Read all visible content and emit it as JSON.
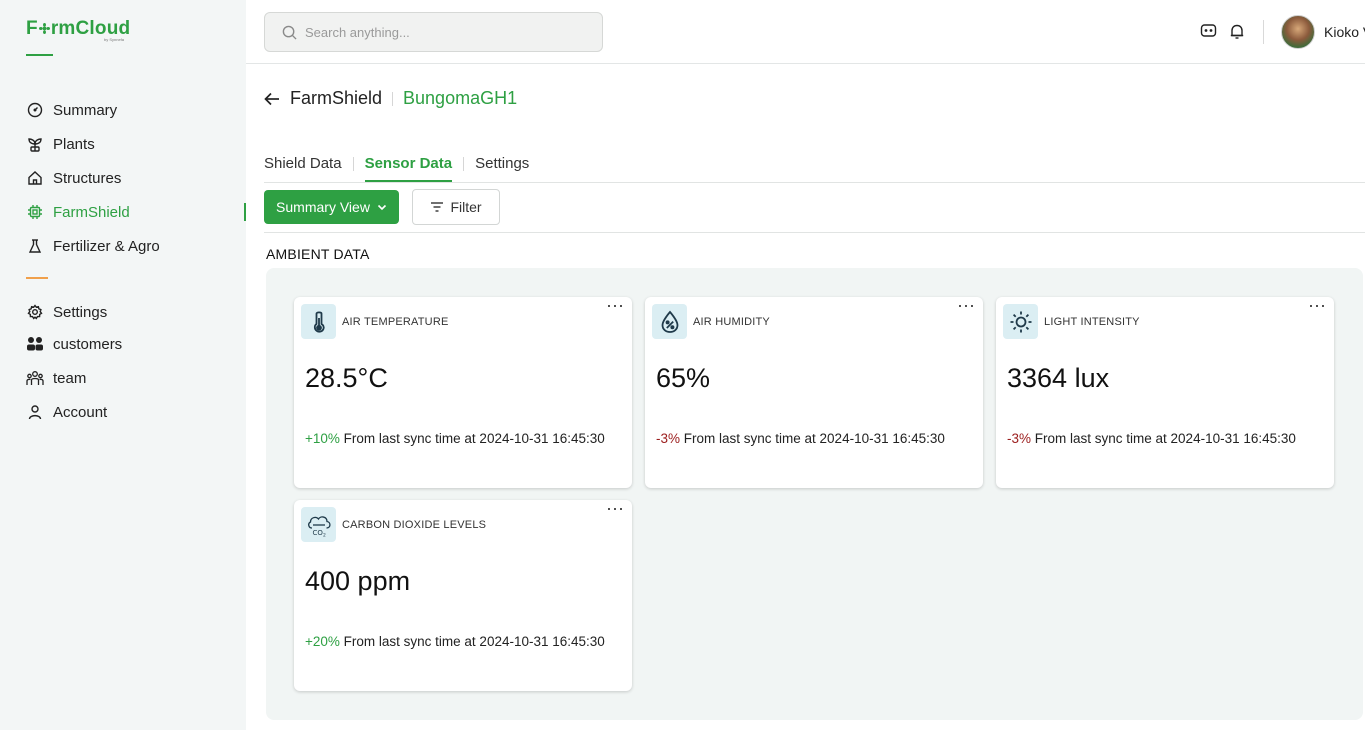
{
  "brand": {
    "logo_pre": "F",
    "logo_post": "rmCloud",
    "logo_sub": "by Synnefa",
    "accent": "#2ea043",
    "divider_color": "#f0a04b"
  },
  "sidebar": {
    "items": [
      {
        "label": "Summary",
        "icon": "gauge-icon"
      },
      {
        "label": "Plants",
        "icon": "sprout-icon"
      },
      {
        "label": "Structures",
        "icon": "house-icon"
      },
      {
        "label": "FarmShield",
        "icon": "chip-icon",
        "active": true
      },
      {
        "label": "Fertilizer & Agro",
        "icon": "flask-icon"
      }
    ],
    "secondary": [
      {
        "label": "Settings",
        "icon": "gear-icon"
      },
      {
        "label": "customers",
        "icon": "customers-icon"
      },
      {
        "label": "team",
        "icon": "team-icon"
      },
      {
        "label": "Account",
        "icon": "user-icon"
      }
    ]
  },
  "header": {
    "search_placeholder": "Search anything...",
    "username": "Kioko V"
  },
  "breadcrumb": {
    "parent": "FarmShield",
    "current": "BungomaGH1"
  },
  "tabs": [
    {
      "label": "Shield Data",
      "active": false
    },
    {
      "label": "Sensor Data",
      "active": true
    },
    {
      "label": "Settings",
      "active": false
    }
  ],
  "controls": {
    "view_label": "Summary View",
    "filter_label": "Filter"
  },
  "section": {
    "title": "AMBIENT DATA"
  },
  "cards": [
    {
      "title": "AIR TEMPERATURE",
      "value": "28.5°C",
      "delta": "+10%",
      "delta_dir": "up",
      "note": " From last sync time at 2024-10-31 16:45:30",
      "icon": "thermometer-icon"
    },
    {
      "title": "AIR HUMIDITY",
      "value": "65%",
      "delta": "-3%",
      "delta_dir": "down",
      "note": " From last sync time at 2024-10-31 16:45:30",
      "icon": "humidity-drop-icon"
    },
    {
      "title": "LIGHT INTENSITY",
      "value": "3364 lux",
      "delta": "-3%",
      "delta_dir": "down",
      "note": " From last sync time at 2024-10-31 16:45:30",
      "icon": "sun-icon"
    },
    {
      "title": "CARBON DIOXIDE LEVELS",
      "value": "400 ppm",
      "delta": "+20%",
      "delta_dir": "up",
      "note": " From last sync time at 2024-10-31 16:45:30",
      "icon": "co2-cloud-icon"
    }
  ],
  "more_glyph": "···"
}
